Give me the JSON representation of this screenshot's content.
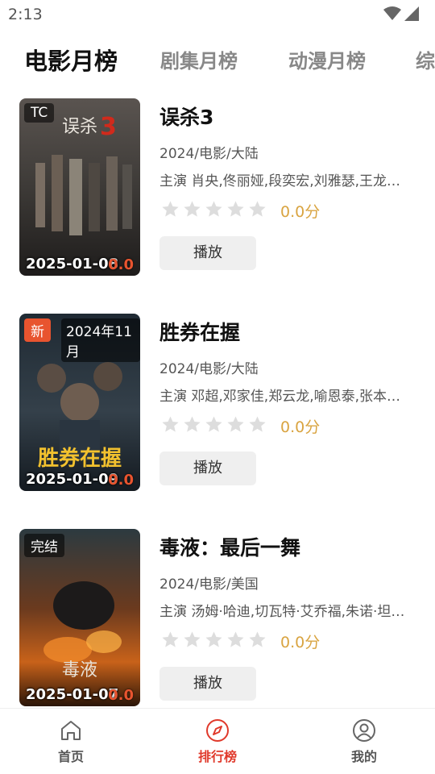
{
  "status_bar": {
    "time": "2:13"
  },
  "tabs": [
    {
      "label": "电影月榜",
      "active": true
    },
    {
      "label": "剧集月榜",
      "active": false
    },
    {
      "label": "动漫月榜",
      "active": false
    },
    {
      "label": "综",
      "active": false
    }
  ],
  "items": [
    {
      "title": "误杀3",
      "meta": "2024/电影/大陆",
      "cast": "主演 肖央,佟丽娅,段奕宏,刘雅瑟,王龙…",
      "score": "0.0分",
      "rating_stars": 0,
      "play_label": "播放",
      "poster": {
        "badge": "TC",
        "badge_style": "dark",
        "season_tag": "",
        "date": "2025-01-08",
        "score": "0.0"
      }
    },
    {
      "title": "胜券在握",
      "meta": "2024/电影/大陆",
      "cast": "主演 邓超,邓家佳,郑云龙,喻恩泰,张本…",
      "score": "0.0分",
      "rating_stars": 0,
      "play_label": "播放",
      "poster": {
        "badge": "新",
        "badge_style": "red",
        "season_tag": "2024年11月",
        "date": "2025-01-09",
        "score": "0.0"
      }
    },
    {
      "title": "毒液：最后一舞",
      "meta": "2024/电影/美国",
      "cast": "主演 汤姆·哈迪,切瓦特·艾乔福,朱诺·坦…",
      "score": "0.0分",
      "rating_stars": 0,
      "play_label": "播放",
      "poster": {
        "badge": "完结",
        "badge_style": "dark",
        "season_tag": "",
        "date": "2025-01-07",
        "score": "0.0"
      }
    }
  ],
  "bottom_nav": [
    {
      "label": "首页",
      "icon": "home-icon",
      "active": false
    },
    {
      "label": "排行榜",
      "icon": "compass-icon",
      "active": true
    },
    {
      "label": "我的",
      "icon": "user-icon",
      "active": false
    }
  ],
  "colors": {
    "accent": "#e0392b",
    "score": "#d9a441",
    "star_empty": "#dddddd"
  }
}
